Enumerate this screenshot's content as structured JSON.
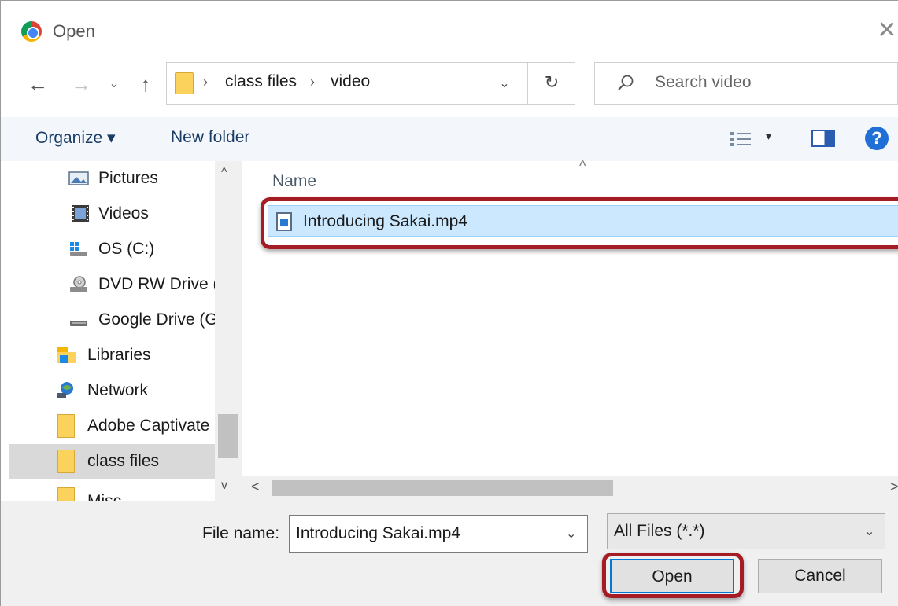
{
  "window": {
    "title": "Open",
    "close_glyph": "✕"
  },
  "navigation": {
    "back_glyph": "←",
    "forward_glyph": "→",
    "recent_glyph": "⌄",
    "up_glyph": "↑"
  },
  "address_bar": {
    "separator": "›",
    "crumbs": [
      "class files",
      "video"
    ],
    "dropdown_glyph": "⌄",
    "refresh_glyph": "↻"
  },
  "search": {
    "placeholder": "Search video"
  },
  "toolbar": {
    "organize_label": "Organize ▾",
    "new_folder_label": "New folder",
    "view_dropdown_glyph": "▾",
    "help_glyph": "?"
  },
  "nav_pane": {
    "items": [
      {
        "label": "Pictures",
        "icon": "pictures-icon"
      },
      {
        "label": "Videos",
        "icon": "videos-icon"
      },
      {
        "label": "OS (C:)",
        "icon": "drive-icon"
      },
      {
        "label": "DVD RW Drive (",
        "icon": "dvd-drive-icon"
      },
      {
        "label": "Google Drive (G",
        "icon": "drive-icon"
      },
      {
        "label": "Libraries",
        "icon": "libraries-icon"
      },
      {
        "label": "Network",
        "icon": "network-icon"
      },
      {
        "label": "Adobe Captivate",
        "icon": "folder-icon"
      },
      {
        "label": "class files",
        "icon": "folder-icon",
        "selected": true
      },
      {
        "label": "Misc",
        "icon": "folder-icon"
      }
    ],
    "scroll_up_glyph": "^",
    "scroll_down_glyph": "v"
  },
  "file_list": {
    "sort_glyph": "^",
    "column_name": "Name",
    "files": [
      {
        "name": "Introducing Sakai.mp4",
        "selected": true
      }
    ],
    "scroll_left_glyph": "<",
    "scroll_right_glyph": ">"
  },
  "bottom": {
    "file_name_label": "File name:",
    "file_name_value": "Introducing Sakai.mp4",
    "file_name_dropdown_glyph": "⌄",
    "file_type_value": "All Files (*.*)",
    "file_type_dropdown_glyph": "⌄",
    "open_label": "Open",
    "cancel_label": "Cancel"
  },
  "colors": {
    "highlight": "#a51c24",
    "selection": "#cce8ff",
    "toolbar_bg": "#f3f6fb",
    "primary_button_border": "#0078d7"
  }
}
